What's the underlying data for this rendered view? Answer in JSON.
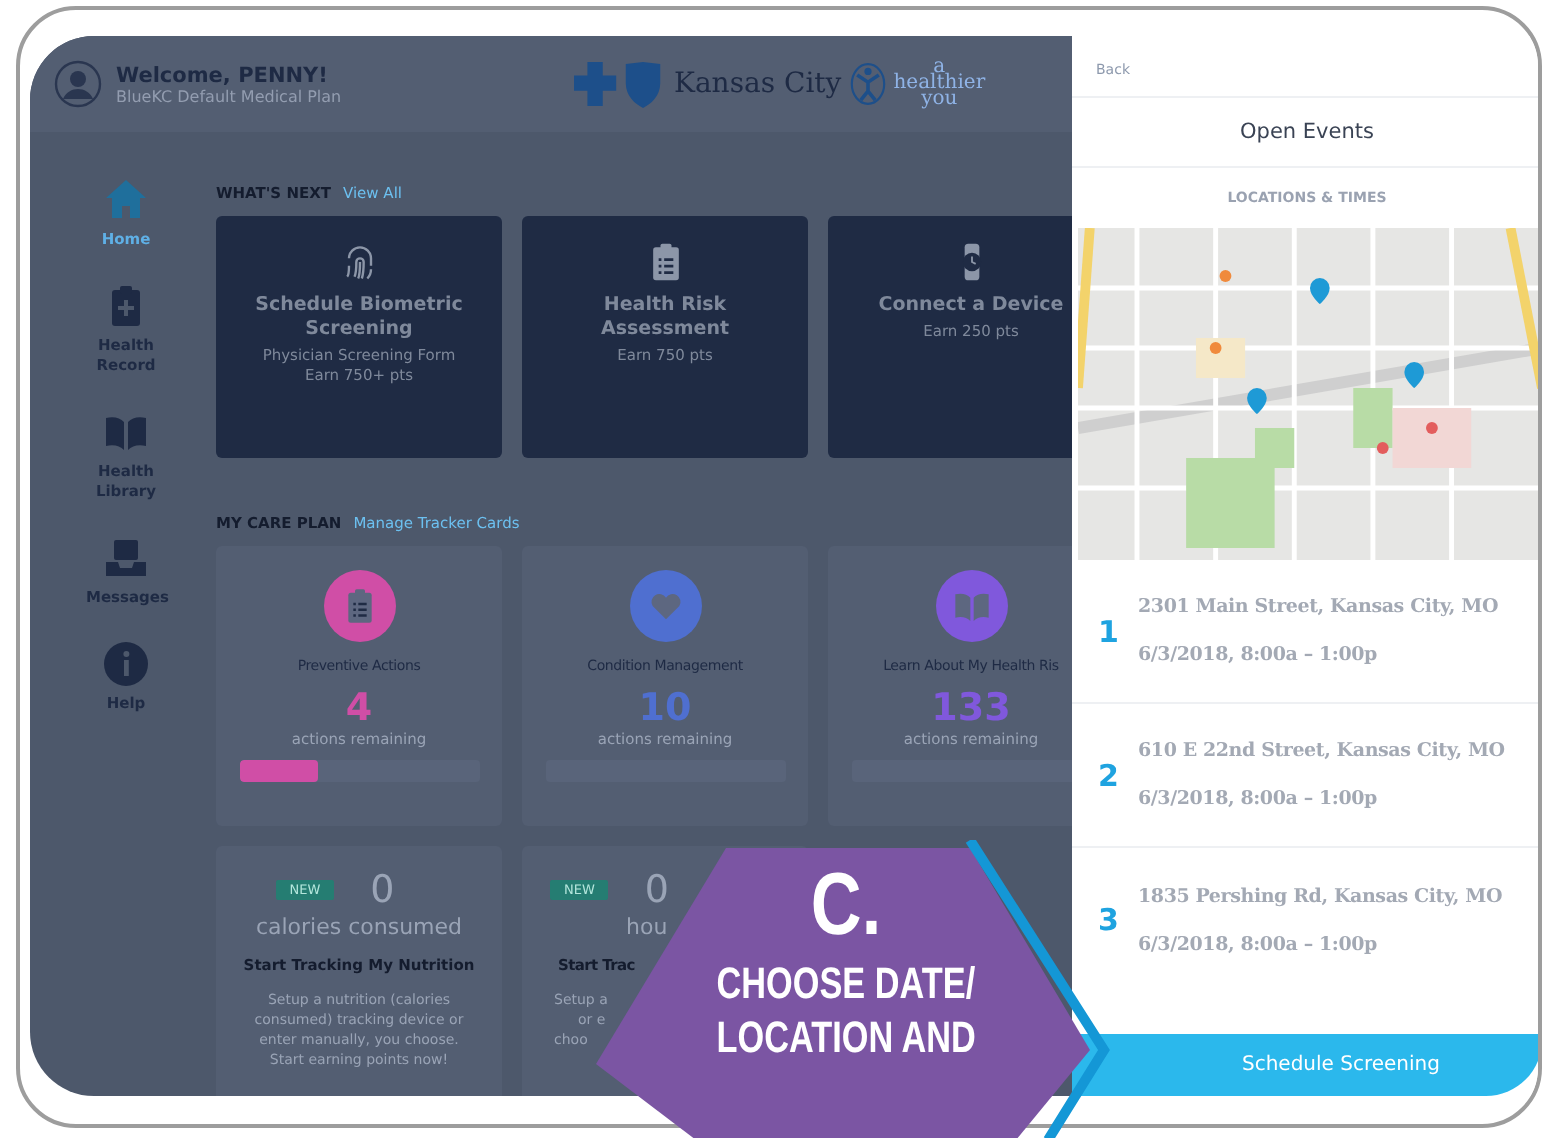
{
  "header": {
    "welcome": "Welcome, PENNY!",
    "plan": "BlueKC Default Medical Plan",
    "logo_text": "Kansas City",
    "tagline_lines": [
      "a",
      "healthier",
      "you"
    ]
  },
  "sidebar": {
    "items": [
      {
        "label": "Home",
        "kind": "home",
        "selected": true
      },
      {
        "label": "Health Record",
        "kind": "record",
        "selected": false
      },
      {
        "label": "Health Library",
        "kind": "book",
        "selected": false
      },
      {
        "label": "Messages",
        "kind": "inbox",
        "selected": false
      },
      {
        "label": "Help",
        "kind": "info",
        "selected": false
      }
    ]
  },
  "whats_next": {
    "heading": "WHAT'S NEXT",
    "link": "View All",
    "cards": [
      {
        "kind": "fingerprint",
        "title": "Schedule Biometric Screening",
        "subtitle_lines": [
          "Physician Screening Form",
          "Earn 750+ pts"
        ]
      },
      {
        "kind": "clipboard",
        "title": "Health Risk Assessment",
        "subtitle_lines": [
          "Earn 750 pts"
        ]
      },
      {
        "kind": "watch",
        "title": "Connect a Device",
        "subtitle_lines": [
          "Earn 250 pts"
        ]
      }
    ]
  },
  "care_plan": {
    "heading": "MY CARE PLAN",
    "link": "Manage Tracker Cards",
    "cards": [
      {
        "kind": "clipboard",
        "color": "#d04ea6",
        "title": "Preventive Actions",
        "count": "4",
        "caption": "actions remaining",
        "level": 0.33
      },
      {
        "kind": "heart",
        "color": "#4f6fd0",
        "title": "Condition Management",
        "count": "10",
        "caption": "actions remaining",
        "level": 0
      },
      {
        "kind": "book",
        "color": "#8058dc",
        "title": "Learn About My Health Ris",
        "count": "133",
        "caption": "actions remaining",
        "level": 0
      }
    ]
  },
  "trackers": [
    {
      "badge": "NEW",
      "count": "0",
      "unit": "calories consumed",
      "title": "Start Tracking My Nutrition",
      "description_lines": [
        "Setup a nutrition (calories",
        "consumed) tracking device or",
        "enter manually, you choose.",
        "Start earning points now!"
      ]
    },
    {
      "badge": "NEW",
      "count": "0",
      "unit": "hou",
      "title": "Start Trac",
      "description_lines": [
        "Setup a",
        "or e",
        "choo"
      ]
    }
  ],
  "panel": {
    "back": "Back",
    "title": "Open Events",
    "section": "LOCATIONS & TIMES",
    "locations": [
      {
        "number": "1",
        "address": "2301 Main Street, Kansas City, MO",
        "time": "6/3/2018, 8:00a – 1:00p"
      },
      {
        "number": "2",
        "address": "610 E 22nd Street, Kansas City, MO",
        "time": "6/3/2018, 8:00a – 1:00p"
      },
      {
        "number": "3",
        "address": "1835 Pershing Rd, Kansas City, MO",
        "time": "6/3/2018, 8:00a – 1:00p"
      }
    ],
    "button": "Schedule Screening"
  },
  "callout": {
    "letter": "C.",
    "lines": [
      "CHOOSE DATE/",
      "LOCATION AND"
    ]
  }
}
